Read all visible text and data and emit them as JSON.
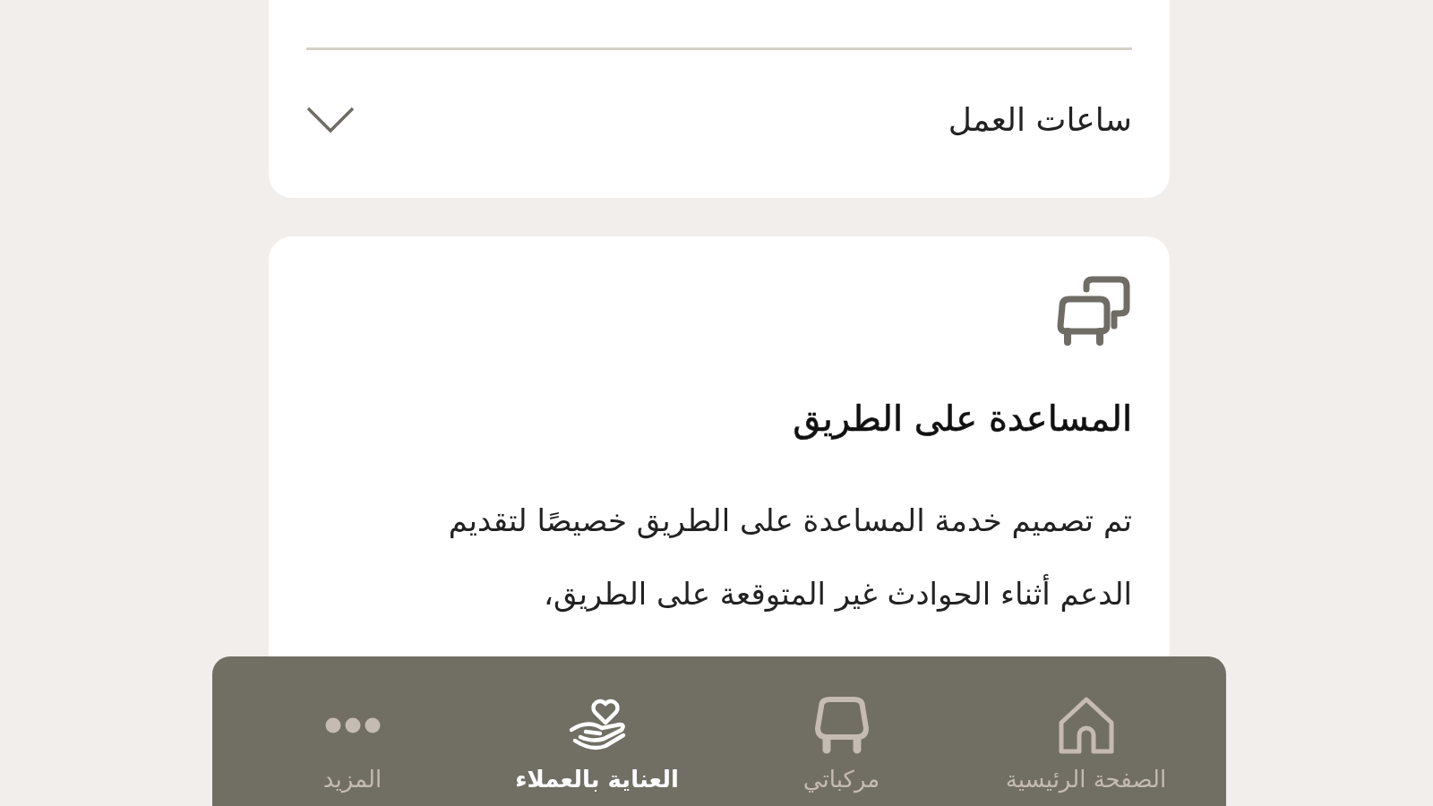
{
  "hours_section": {
    "title": "ساعات العمل",
    "expanded": false
  },
  "service_card": {
    "title": "المساعدة على الطريق",
    "description": "تم تصميم خدمة المساعدة على الطريق خصيصًا لتقديم الدعم أثناء الحوادث غير المتوقعة على الطريق،"
  },
  "bottom_nav": [
    {
      "label": "الصفحة الرئيسية",
      "kind": "home",
      "selected": false
    },
    {
      "label": "مركباتي",
      "kind": "vehicles",
      "selected": false
    },
    {
      "label": "العناية بالعملاء",
      "kind": "care",
      "selected": true
    },
    {
      "label": "المزيد",
      "kind": "more",
      "selected": false
    }
  ]
}
